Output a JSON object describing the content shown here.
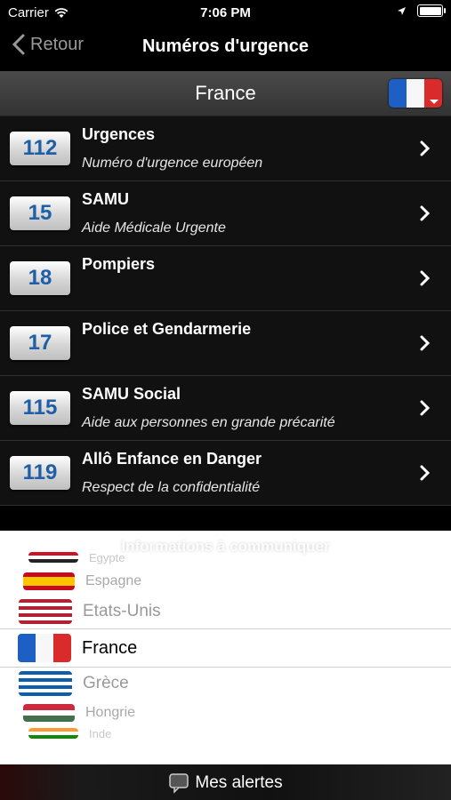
{
  "status": {
    "carrier": "Carrier",
    "time": "7:06 PM"
  },
  "nav": {
    "back_label": "Retour",
    "title": "Numéros d'urgence"
  },
  "country": {
    "name": "France"
  },
  "emergency": [
    {
      "number": "112",
      "label": "Urgences",
      "subtitle": "Numéro d'urgence européen"
    },
    {
      "number": "15",
      "label": "SAMU",
      "subtitle": "Aide Médicale Urgente"
    },
    {
      "number": "18",
      "label": "Pompiers",
      "subtitle": ""
    },
    {
      "number": "17",
      "label": "Police et Gendarmerie",
      "subtitle": ""
    },
    {
      "number": "115",
      "label": "SAMU Social",
      "subtitle": "Aide aux personnes en grande précarité"
    },
    {
      "number": "119",
      "label": "Allô Enfance en Danger",
      "subtitle": "Respect de la confidentialité"
    }
  ],
  "picker": {
    "info_label": "Informations à communiquer",
    "countries": [
      "Egypte",
      "Espagne",
      "Etats-Unis",
      "France",
      "Grèce",
      "Hongrie",
      "Inde"
    ],
    "selected": "France"
  },
  "bottom": {
    "alerts_label": "Mes alertes"
  },
  "colors": {
    "number_blue": "#1f5fa8",
    "flag_blue": "#1d5fc4",
    "flag_red": "#d92b2b"
  }
}
